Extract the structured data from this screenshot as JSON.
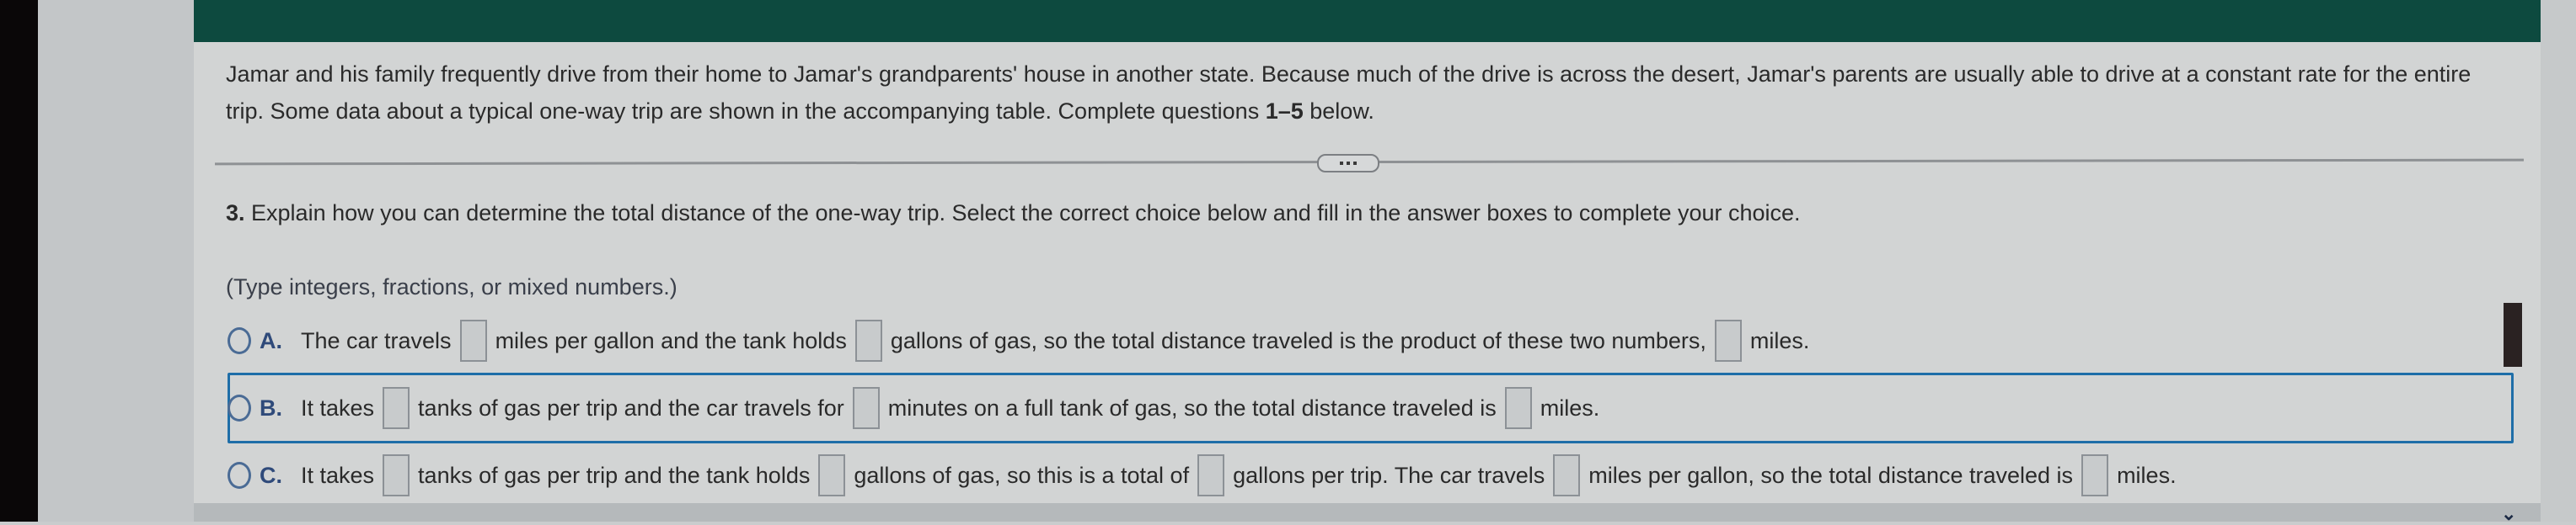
{
  "intro": {
    "text_before_bold": "Jamar and his family frequently drive from their home to Jamar's grandparents' house in another state. Because much of the drive is across the desert, Jamar's parents are usually able to drive at a constant rate for the entire trip. Some data about a typical one-way trip are shown in the accompanying table. Complete questions ",
    "bold": "1–5",
    "text_after_bold": " below."
  },
  "more_button": {
    "icon": "more-horizontal-icon"
  },
  "question": {
    "number": "3.",
    "text": " Explain how you can determine the total distance of the one-way trip. Select the correct choice below and fill in the answer boxes to complete your choice."
  },
  "hint": "(Type integers, fractions, or mixed numbers.)",
  "choices": [
    {
      "letter": "A.",
      "selected": false,
      "segments": [
        "The car travels",
        "miles per gallon and the tank holds",
        "gallons of gas, so the total distance traveled is the product of these two numbers,",
        "miles."
      ],
      "answers": [
        "",
        "",
        ""
      ]
    },
    {
      "letter": "B.",
      "selected": false,
      "segments": [
        "It takes",
        "tanks of gas per trip and the car travels for",
        "minutes on a full tank of gas, so the total distance traveled is",
        "miles."
      ],
      "answers": [
        "",
        "",
        ""
      ]
    },
    {
      "letter": "C.",
      "selected": false,
      "segments": [
        "It takes",
        "tanks of gas per trip and the tank holds",
        "gallons of gas, so this is a total of",
        "gallons per trip. The car travels",
        "miles per gallon, so the total distance traveled is",
        "miles."
      ],
      "answers": [
        "",
        "",
        "",
        "",
        ""
      ]
    }
  ],
  "colors": {
    "header": "#0d4a3f",
    "focus_border": "#1e6ea8",
    "radio": "#4a6b95"
  },
  "bottom_bar": {
    "icon": "chevron-down-icon",
    "glyph": "⌄"
  }
}
